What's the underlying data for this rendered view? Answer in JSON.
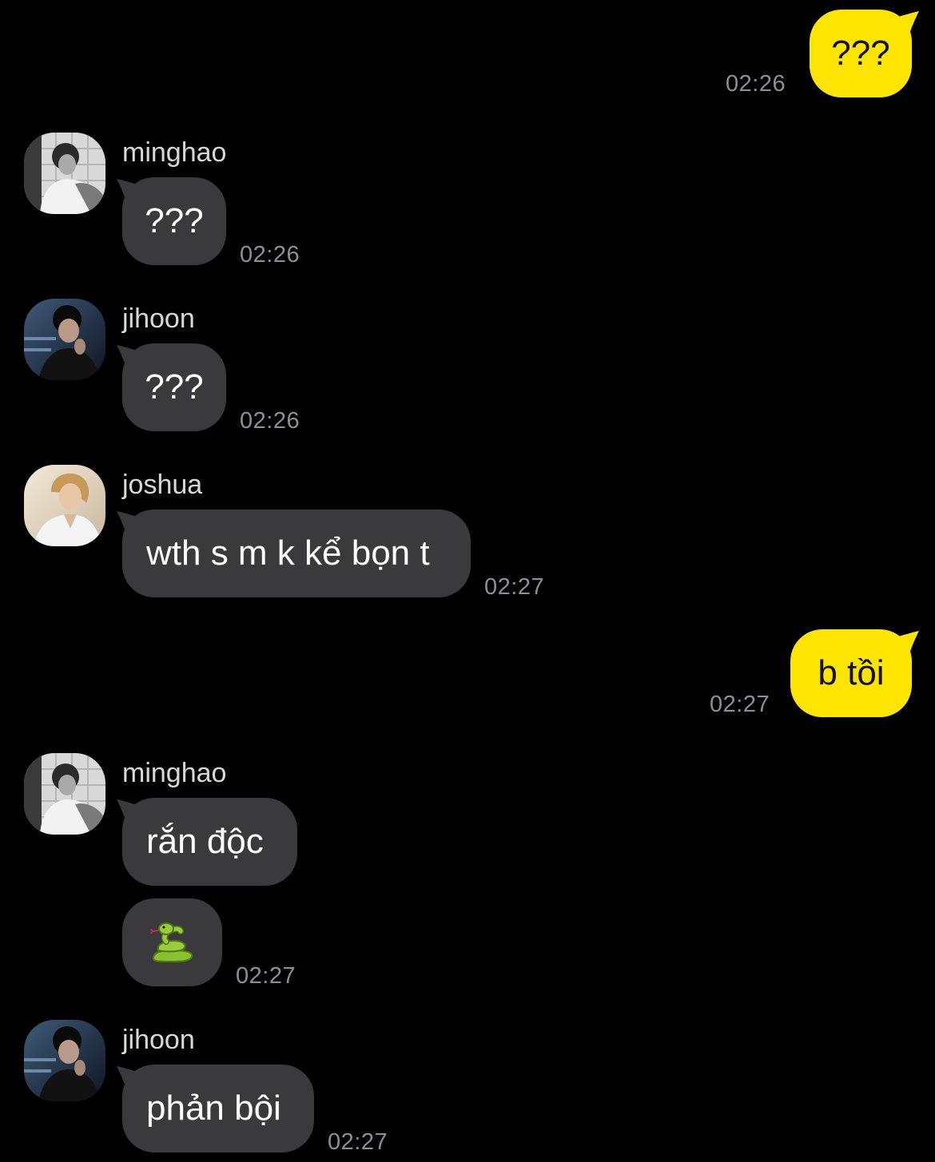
{
  "messages": [
    {
      "direction": "out",
      "text": "???",
      "time": "02:26"
    },
    {
      "direction": "in",
      "sender": "minghao",
      "text": "???",
      "time": "02:26"
    },
    {
      "direction": "in",
      "sender": "jihoon",
      "text": "???",
      "time": "02:26"
    },
    {
      "direction": "in",
      "sender": "joshua",
      "text": "wth s m k kể bọn t",
      "time": "02:27"
    },
    {
      "direction": "out",
      "text": "b tồi",
      "time": "02:27"
    },
    {
      "direction": "in",
      "sender": "minghao",
      "text": "rắn độc"
    },
    {
      "direction": "in",
      "sender": "minghao",
      "emoji": "snake-emoji",
      "time": "02:27"
    },
    {
      "direction": "in",
      "sender": "jihoon",
      "text": "phản bội",
      "time": "02:27"
    }
  ],
  "colors": {
    "background": "#000000",
    "incoming_bubble": "#3a3a3c",
    "outgoing_bubble": "#fee500",
    "timestamp": "#8e8e93"
  }
}
